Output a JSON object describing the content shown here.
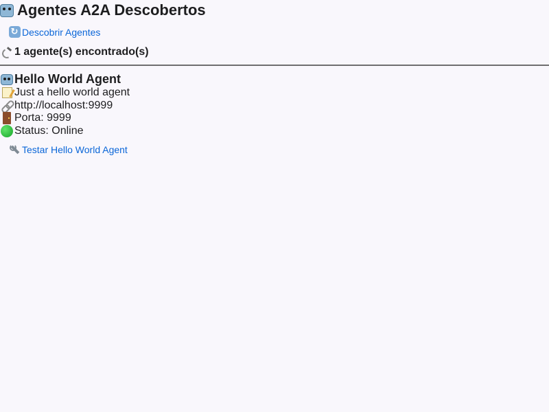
{
  "header": {
    "title": "Agentes A2A Descobertos",
    "icon": "robot-icon"
  },
  "actions": {
    "discover_label": "Descobrir Agentes",
    "discover_icon": "refresh-icon"
  },
  "results": {
    "count_text": "1 agente(s) encontrado(s)",
    "count_icon": "satellite-antenna-icon"
  },
  "agents": [
    {
      "name": "Hello World Agent",
      "description": "Just a hello world agent",
      "url": "http://localhost:9999",
      "port_text": "Porta: 9999",
      "status_text": "Status: Online",
      "status_color": "#17a52a",
      "test_label": "Testar Hello World Agent"
    }
  ],
  "colors": {
    "link": "#0a66d8",
    "background": "#f9f7fc",
    "divider": "#6e6e6e"
  }
}
